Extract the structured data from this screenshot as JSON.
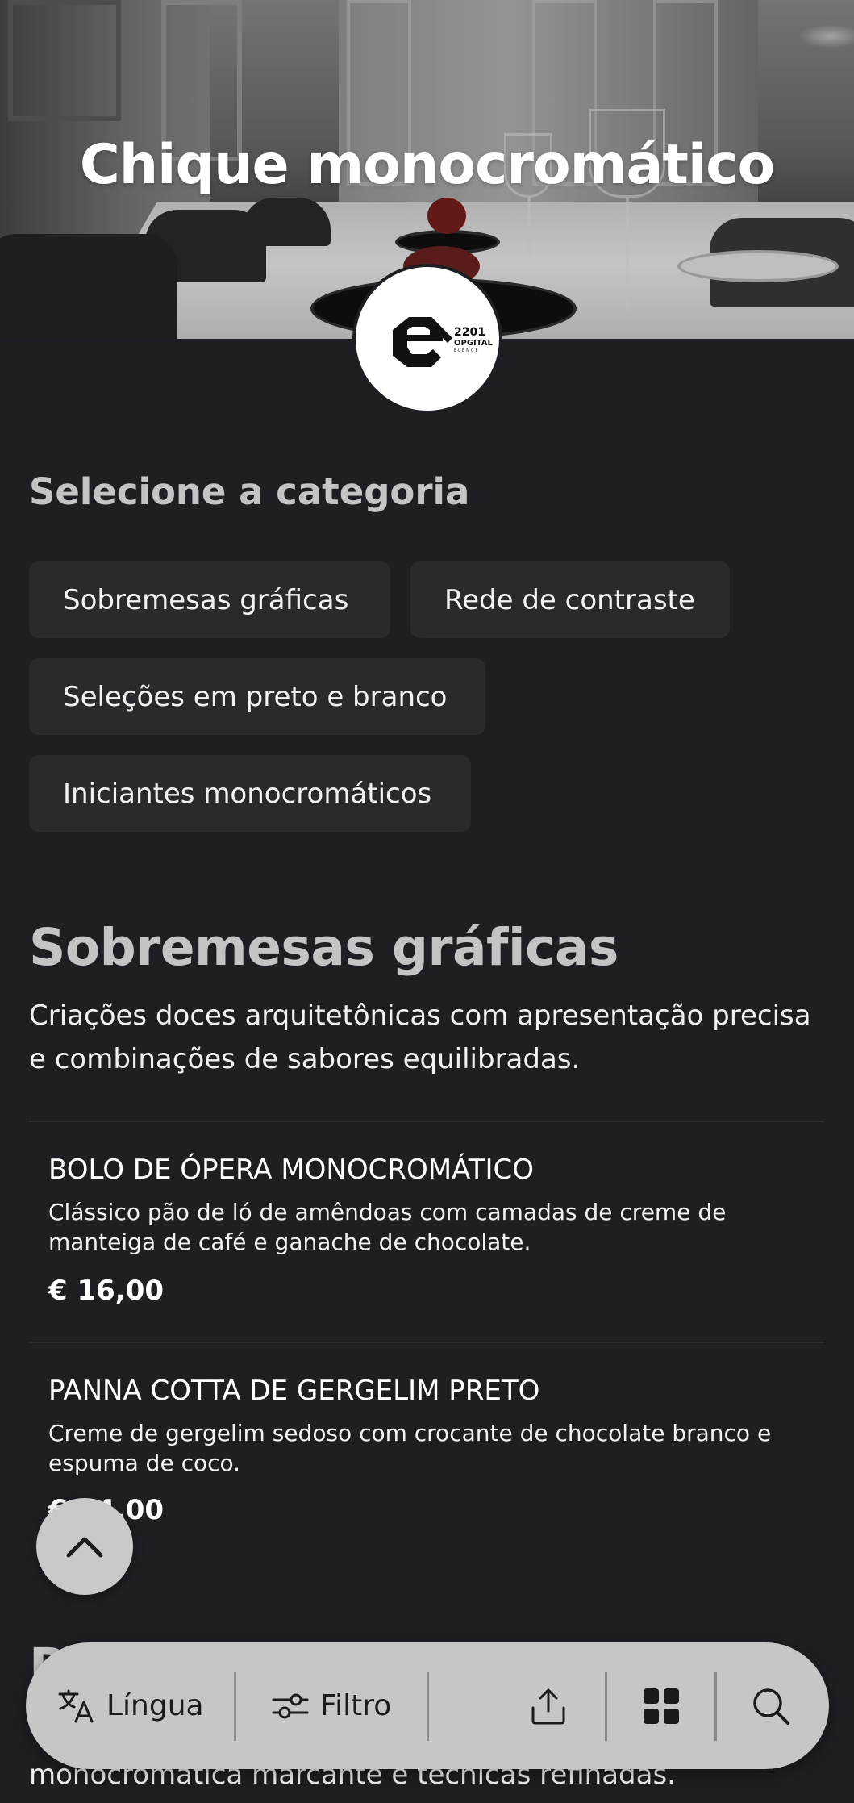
{
  "hero": {
    "title": "Chique monocromático"
  },
  "logo": {
    "line1": "2201",
    "line2": "OPGITAL",
    "line3": "ELENCE"
  },
  "category": {
    "title": "Selecione a categoria",
    "chips": [
      "Sobremesas gráficas",
      "Rede de contraste",
      "Seleções em preto e branco",
      "Iniciantes monocromáticos"
    ]
  },
  "section": {
    "title": "Sobremesas gráficas",
    "description": "Criações doces arquitetônicas com apresentação precisa e combinações de sabores equilibradas.",
    "items": [
      {
        "name": "BOLO DE ÓPERA MONOCROMÁTICO",
        "description": "Clássico pão de ló de amêndoas com camadas de creme de manteiga de café e ganache de chocolate.",
        "price": "€ 16,00"
      },
      {
        "name": "PANNA COTTA DE GERGELIM PRETO",
        "description": "Creme de gergelim sedoso com crocante de chocolate branco e espuma de coco.",
        "price": "€ 14,00"
      }
    ]
  },
  "next_section": {
    "title_fragment": "R",
    "description_fragment": "monocromática marcante e técnicas refinadas."
  },
  "bottom_bar": {
    "language_label": "Língua",
    "filter_label": "Filtro",
    "icons": [
      "translate-icon",
      "filter-icon",
      "share-icon",
      "grid-icon",
      "search-icon"
    ]
  },
  "colors": {
    "background": "#1e1f23",
    "chip": "#292a2e",
    "heading": "#c4c4c4",
    "bar": "#c6c6c6"
  }
}
